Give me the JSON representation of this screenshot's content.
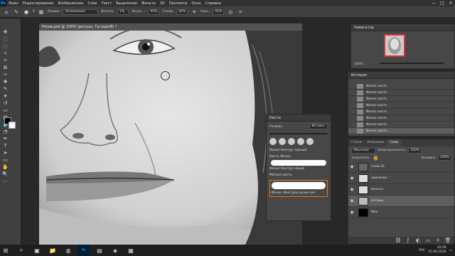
{
  "menubar": {
    "app_icon": "Ps",
    "items": [
      "Файл",
      "Редактирование",
      "Изображение",
      "Слои",
      "Текст",
      "Выделение",
      "Фильтр",
      "3D",
      "Просмотр",
      "Окно",
      "Справка"
    ],
    "window_controls": [
      "—",
      "□",
      "✕"
    ]
  },
  "optionsbar": {
    "brush_size": "9",
    "mode_label": "Режим:",
    "mode_value": "Затемнение",
    "strength_label": "Вплоть:",
    "strength_value": "1%",
    "opacity_label": "Затуп...:",
    "opacity_value": "45%",
    "flow_label": "Слева:",
    "flow_value": "44%",
    "angle_label": "Наж.:",
    "angle_value": "45%",
    "extra_label": "45%"
  },
  "document": {
    "tab_title": "Ponoa.psd @ 100% (ретушь, Гр.серо/8) *"
  },
  "navigator": {
    "title": "Навигатор",
    "zoom": "100%"
  },
  "history": {
    "title": "История",
    "items": [
      "Фонос кисть",
      "Фонос кисть",
      "Фонос кисть",
      "Фонос кисть",
      "Фонос кисть",
      "Фонос кисть",
      "Фонос кисть",
      "Фонос кисть"
    ]
  },
  "brushes": {
    "title": "Кисти",
    "size_label": "Размер:",
    "size_value": "80 пикс.",
    "items": [
      "Фонос Контур черный",
      "Кисть Фонос",
      "Фонос Контур серый",
      "Мягкая кисть",
      "Фонос Фактура размытая"
    ],
    "selected_label": "Фонос Фактура размытия"
  },
  "layers": {
    "tabs": [
      "Стили",
      "Операции",
      "Слои"
    ],
    "blend_label": "Обычные",
    "opacity_label": "Непрозрачность:",
    "opacity_value": "100%",
    "lock_label": "Закрепить:",
    "fill_label": "Заливка:",
    "fill_value": "100%",
    "rows": [
      {
        "name": "Слой 22",
        "selected": false
      },
      {
        "name": "оригинал",
        "selected": false
      },
      {
        "name": "волосы",
        "selected": false
      },
      {
        "name": "ретушь",
        "selected": true
      },
      {
        "name": "Фон",
        "selected": false
      }
    ]
  },
  "taskbar": {
    "time": "20:06",
    "date": "15.06.2024",
    "language": "РУС"
  }
}
